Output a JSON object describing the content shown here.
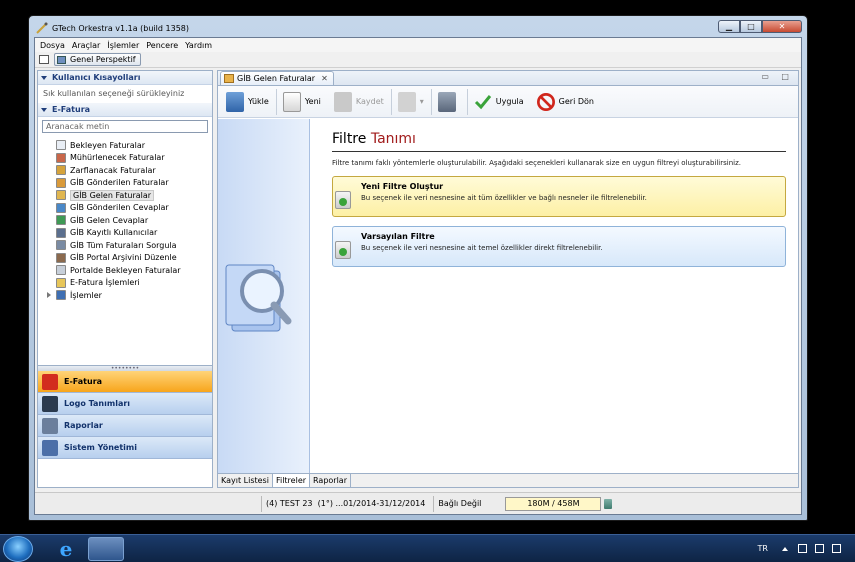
{
  "window": {
    "title": "GTech Orkestra v1.1a (build 1358)",
    "min": "▁",
    "max": "□",
    "close": "✕"
  },
  "menubar": [
    "Dosya",
    "Araçlar",
    "İşlemler",
    "Pencere",
    "Yardım"
  ],
  "perspective": {
    "label": "Genel Perspektif"
  },
  "left": {
    "shortcuts_header": "Kullanıcı Kısayolları",
    "shortcuts_hint": "Sık kullanılan seçeneği sürükleyiniz",
    "efatura_header": "E-Fatura",
    "search_placeholder": "Aranacak metin",
    "tree": [
      {
        "label": "Bekleyen Faturalar",
        "color": "#e9eef5"
      },
      {
        "label": "Mühürlenecek Faturalar",
        "color": "#c9674a"
      },
      {
        "label": "Zarflanacak Faturalar",
        "color": "#d5a33c"
      },
      {
        "label": "GİB Gönderilen Faturalar",
        "color": "#d99a3a"
      },
      {
        "label": "GİB Gelen Faturalar",
        "color": "#e0b650"
      },
      {
        "label": "GİB Gönderilen Cevaplar",
        "color": "#4a88c8"
      },
      {
        "label": "GİB Gelen Cevaplar",
        "color": "#3f9a55"
      },
      {
        "label": "GİB Kayıtlı Kullanıcılar",
        "color": "#5b6f8e"
      },
      {
        "label": "GİB Tüm Faturaları Sorgula",
        "color": "#7a8ba3"
      },
      {
        "label": "GİB Portal Arşivini Düzenle",
        "color": "#8b6a4e"
      },
      {
        "label": "Portalde Bekleyen Faturalar",
        "color": "#c7cfd9"
      },
      {
        "label": "E-Fatura İşlemleri",
        "color": "#e7c65a"
      },
      {
        "label": "İşlemler",
        "color": "#3f6fb2"
      }
    ],
    "grip": "••••••••",
    "nav": [
      {
        "label": "E-Fatura",
        "color": "#d22b1e"
      },
      {
        "label": "Logo Tanımları",
        "color": "#2a3a4f"
      },
      {
        "label": "Raporlar",
        "color": "#6b7f9c"
      },
      {
        "label": "Sistem Yönetimi",
        "color": "#4c6fa8"
      }
    ]
  },
  "editor": {
    "tab_label": "GİB Gelen Faturalar",
    "tab_close": "✕",
    "tab_controls": "▭ □",
    "toolbar": {
      "load": "Yükle",
      "new": "Yeni",
      "save": "Kaydet",
      "dropdown_arrow": "▾",
      "apply": "Uygula",
      "back": "Geri Dön"
    },
    "page_title_part1": "Filtre",
    "page_title_part2": "Tanımı",
    "page_desc": "Filtre tanımı faklı yöntemlerle oluşturulabilir. Aşağıdaki seçenekleri kullanarak size en uygun filtreyi oluşturabilirsiniz.",
    "options": [
      {
        "title": "Yeni Filtre Oluştur",
        "desc": "Bu seçenek ile veri nesnesine ait tüm özellikler ve bağlı nesneler ile filtrelenebilir."
      },
      {
        "title": "Varsayılan Filtre",
        "desc": "Bu seçenek ile veri nesnesine ait temel özellikler direkt filtrelenebilir."
      }
    ],
    "bottom_tabs": [
      "Kayıt Listesi",
      "Filtreler",
      "Raporlar"
    ]
  },
  "status": {
    "company": "(4) TEST 23",
    "period": "(1°) ...01/2014-31/12/2014",
    "connection": "Bağlı Değil",
    "memory": "180M / 458M"
  },
  "taskbar": {
    "ie": "e",
    "lang": "TR"
  }
}
